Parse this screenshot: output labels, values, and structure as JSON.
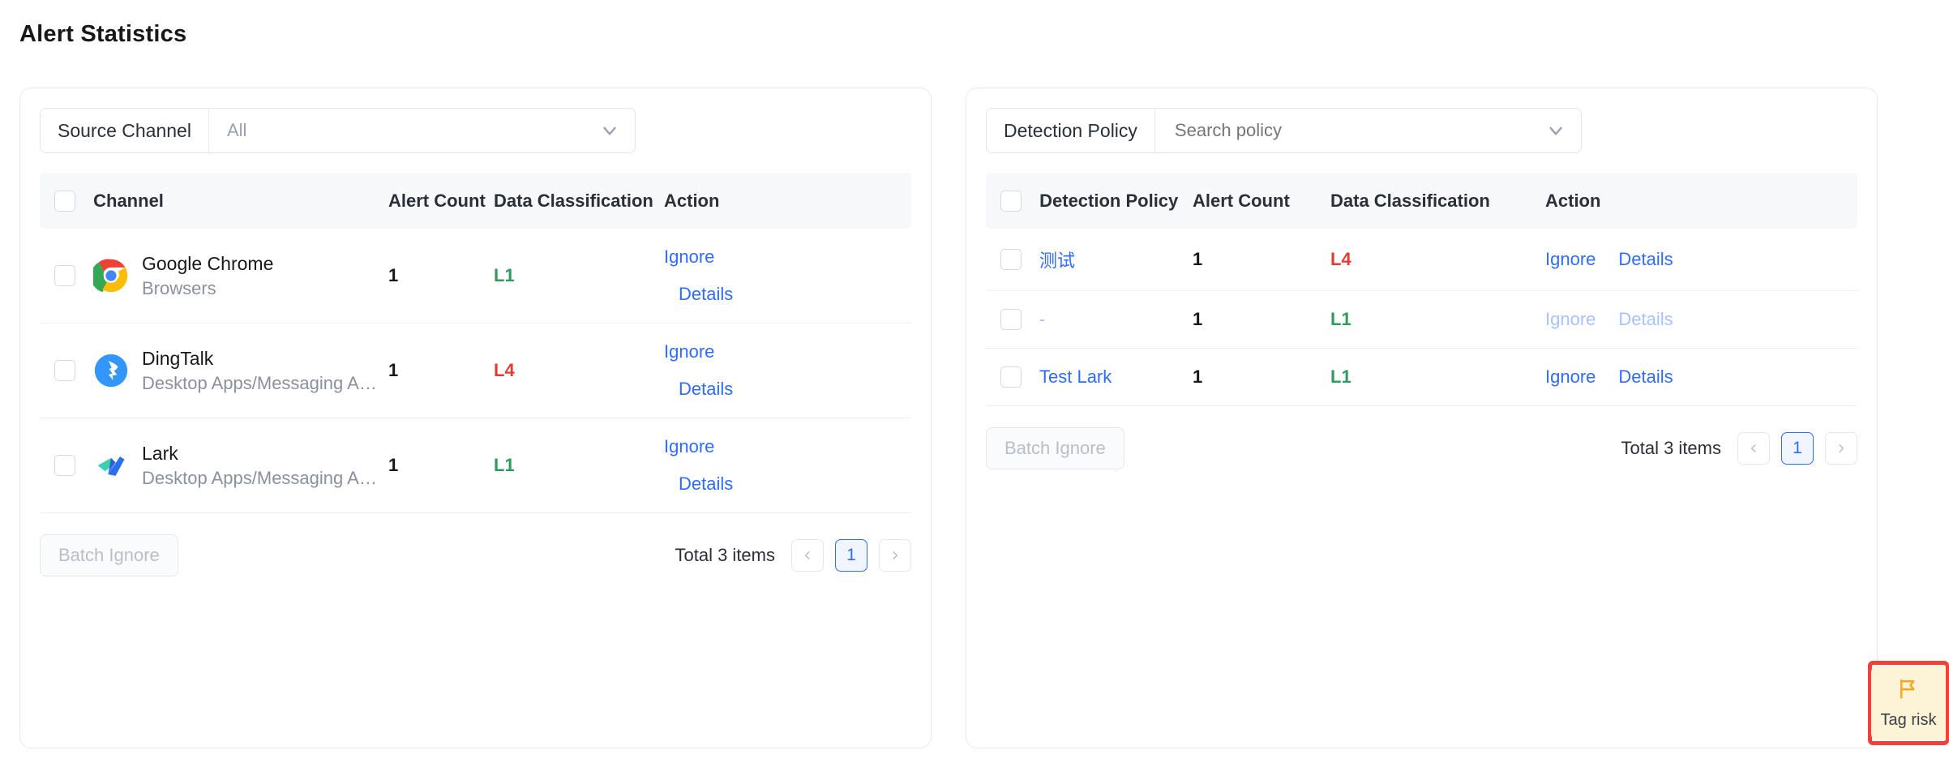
{
  "page": {
    "title": "Alert Statistics"
  },
  "left_panel": {
    "filter": {
      "label": "Source Channel",
      "value": "All",
      "chevron_icon": "chevron-down-icon"
    },
    "columns": [
      "Channel",
      "Alert Count",
      "Data Classification",
      "Action"
    ],
    "rows": [
      {
        "name": "Google Chrome",
        "category": "Browsers",
        "icon": "google-chrome-icon",
        "alert_count": "1",
        "classification": "L1",
        "classification_level": "L1",
        "ignore": "Ignore",
        "details": "Details"
      },
      {
        "name": "DingTalk",
        "category": "Desktop Apps/Messaging A…",
        "icon": "dingtalk-icon",
        "alert_count": "1",
        "classification": "L4",
        "classification_level": "L4",
        "ignore": "Ignore",
        "details": "Details"
      },
      {
        "name": "Lark",
        "category": "Desktop Apps/Messaging A…",
        "icon": "lark-icon",
        "alert_count": "1",
        "classification": "L1",
        "classification_level": "L1",
        "ignore": "Ignore",
        "details": "Details"
      }
    ],
    "footer": {
      "batch_ignore": "Batch Ignore",
      "total": "Total 3 items",
      "prev_icon": "chevron-left-icon",
      "next_icon": "chevron-right-icon",
      "current_page": "1"
    }
  },
  "right_panel": {
    "filter": {
      "label": "Detection Policy",
      "placeholder": "Search policy",
      "value": "",
      "chevron_icon": "chevron-down-icon"
    },
    "columns": [
      "Detection Policy",
      "Alert Count",
      "Data Classification",
      "Action"
    ],
    "rows": [
      {
        "policy": "测试",
        "alert_count": "1",
        "classification": "L4",
        "classification_level": "L4",
        "ignore": "Ignore",
        "details": "Details",
        "disabled": false
      },
      {
        "policy": "-",
        "alert_count": "1",
        "classification": "L1",
        "classification_level": "L1",
        "ignore": "Ignore",
        "details": "Details",
        "disabled": true
      },
      {
        "policy": "Test Lark",
        "alert_count": "1",
        "classification": "L1",
        "classification_level": "L1",
        "ignore": "Ignore",
        "details": "Details",
        "disabled": false
      }
    ],
    "footer": {
      "batch_ignore": "Batch Ignore",
      "total": "Total 3 items",
      "prev_icon": "chevron-left-icon",
      "next_icon": "chevron-right-icon",
      "current_page": "1"
    }
  },
  "tag_risk": {
    "label": "Tag risk",
    "icon": "flag-icon"
  },
  "colors": {
    "link": "#2f6bff",
    "link_disabled": "#a8c2ff",
    "level_l1": "#2e9a5c",
    "level_l4": "#e23b33",
    "highlight_border": "#f2403a",
    "tag_risk_bg": "#fdf3d7",
    "flag": "#f5a623"
  }
}
